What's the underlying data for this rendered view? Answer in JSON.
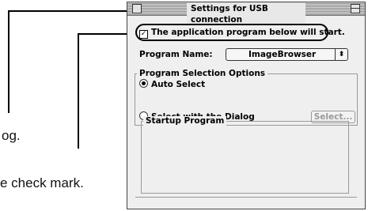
{
  "callouts": {
    "dialog_caption": "og.",
    "check_caption": "e check mark."
  },
  "window": {
    "title": "Settings for USB connection",
    "start_checkbox": {
      "label": "The application program below will start.",
      "checked": true
    },
    "program_name_label": "Program Name:",
    "program_name_value": "ImageBrowser",
    "popup_arrow": "⬍",
    "options_group": {
      "title": "Program Selection Options",
      "auto_select": "Auto Select",
      "select_with_dialog": "Select with the Dialog",
      "select_button": "Select..."
    },
    "startup_group": {
      "title": "Startup Program"
    }
  }
}
